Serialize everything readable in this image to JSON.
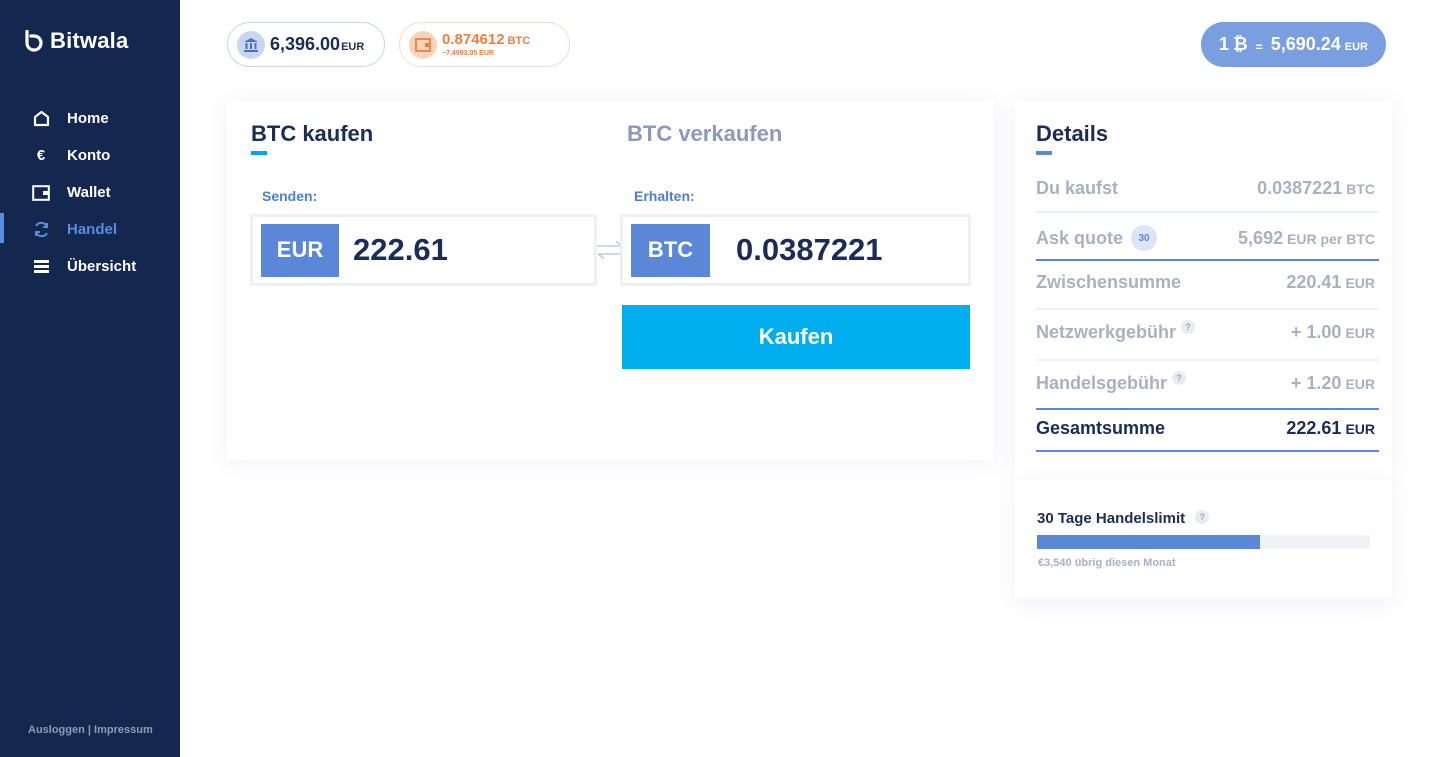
{
  "sidebar": {
    "brand": "Bitwala",
    "items": [
      {
        "label": "Home",
        "icon": "home-icon"
      },
      {
        "label": "Konto",
        "icon": "euro-icon"
      },
      {
        "label": "Wallet",
        "icon": "wallet-icon"
      },
      {
        "label": "Handel",
        "icon": "refresh-icon",
        "active": true
      },
      {
        "label": "Übersicht",
        "icon": "list-icon"
      }
    ],
    "footer": {
      "logout": "Ausloggen",
      "separator": " | ",
      "imprint": "Impressum"
    }
  },
  "topbar": {
    "eur_balance": {
      "amount": "6,396.00",
      "unit": "EUR",
      "icon": "bank-icon"
    },
    "btc_balance": {
      "amount": "0.874612",
      "unit": "BTC",
      "approx": "~7,4993.05 EUR",
      "icon": "wallet-icon"
    },
    "rate": {
      "left": "1",
      "symbol": "₿",
      "equals": "=",
      "value": "5,690.24",
      "unit": "EUR"
    }
  },
  "trade": {
    "tabs": {
      "buy": "BTC kaufen",
      "sell": "BTC verkaufen"
    },
    "send": {
      "label": "Senden:",
      "currency": "EUR",
      "value": "222.61"
    },
    "receive": {
      "label": "Erhalten:",
      "currency": "BTC",
      "value": "0.0387221"
    },
    "buy_button": "Kaufen"
  },
  "details": {
    "title": "Details",
    "rows": [
      {
        "label": "Du kaufst",
        "value": "0.0387221",
        "unit": "BTC"
      },
      {
        "label": "Ask quote",
        "badge": "30",
        "value": "5,692",
        "unit": "EUR per BTC"
      },
      {
        "label": "Zwischensumme",
        "value": "220.41",
        "unit": "EUR"
      },
      {
        "label": "Netzwerkgebühr",
        "help": "?",
        "value": "+ 1.00",
        "unit": "EUR"
      },
      {
        "label": "Handelsgebühr",
        "help": "?",
        "value": "+ 1.20",
        "unit": "EUR"
      },
      {
        "label": "Gesamtsumme",
        "value": "222.61",
        "unit": "EUR"
      }
    ]
  },
  "limit": {
    "title": "30 Tage Handelslimit",
    "help": "?",
    "fill_fraction": 0.67,
    "note": "€3,540 übrig diesen Monat"
  },
  "colors": {
    "sidebar_bg": "#14284f",
    "accent_blue": "#5b87d8",
    "primary_cyan": "#00aeef",
    "btc_orange": "#f07d3c",
    "text_dark": "#1b2d57",
    "text_muted": "#a8b1c2"
  }
}
